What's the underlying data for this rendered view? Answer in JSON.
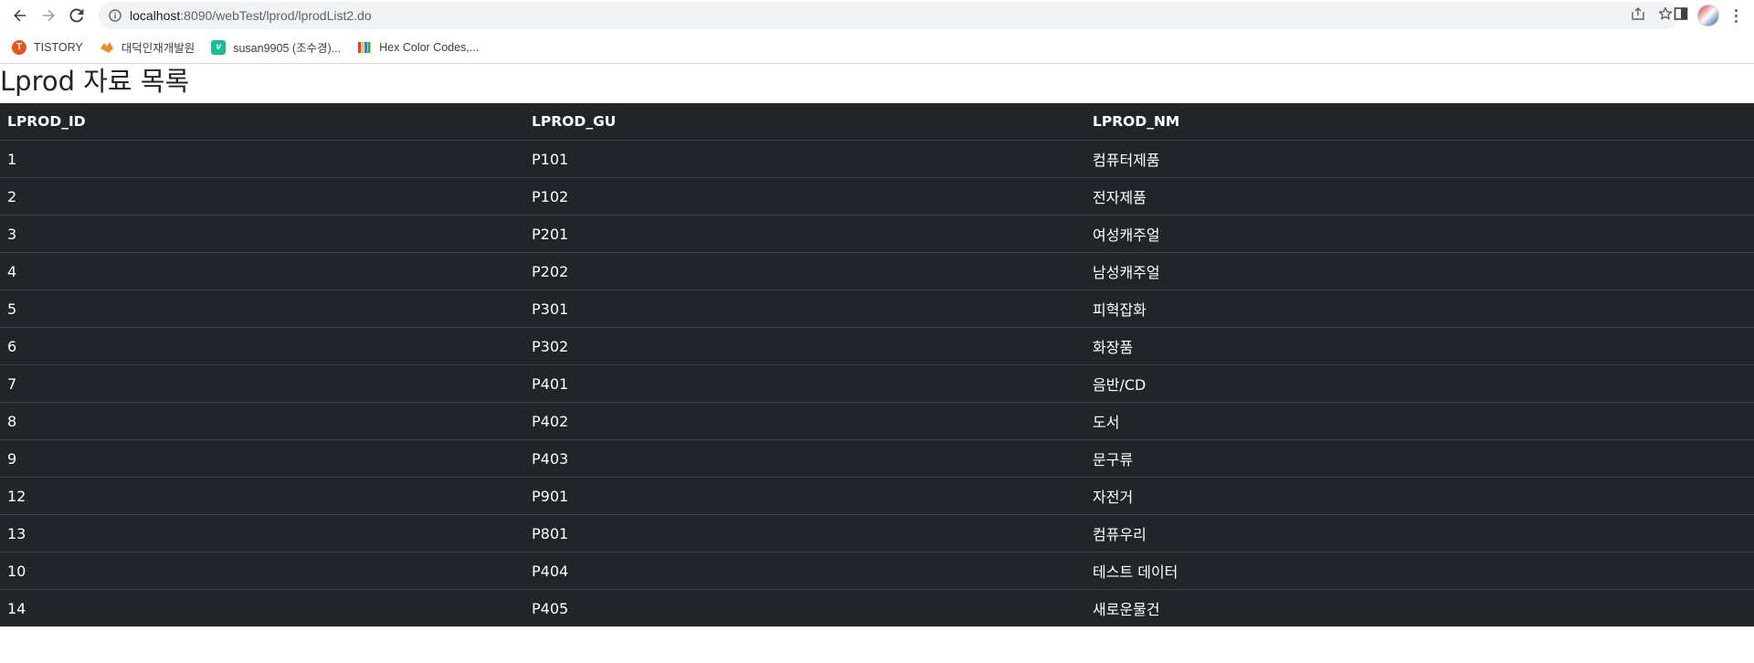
{
  "browser": {
    "url_host": "localhost",
    "url_rest": ":8090/webTest/lprod/lprodList2.do"
  },
  "bookmarks": [
    {
      "label": "TISTORY",
      "icon": "tistory-icon"
    },
    {
      "label": "대덕인재개발원",
      "icon": "daedeok-icon"
    },
    {
      "label": "susan9905 (조수경)...",
      "icon": "velog-icon"
    },
    {
      "label": "Hex Color Codes,...",
      "icon": "hex-color-icon"
    }
  ],
  "page": {
    "title": "Lprod 자료 목록"
  },
  "table": {
    "headers": [
      "LPROD_ID",
      "LPROD_GU",
      "LPROD_NM"
    ],
    "rows": [
      [
        "1",
        "P101",
        "컴퓨터제품"
      ],
      [
        "2",
        "P102",
        "전자제품"
      ],
      [
        "3",
        "P201",
        "여성캐주얼"
      ],
      [
        "4",
        "P202",
        "남성캐주얼"
      ],
      [
        "5",
        "P301",
        "피혁잡화"
      ],
      [
        "6",
        "P302",
        "화장품"
      ],
      [
        "7",
        "P401",
        "음반/CD"
      ],
      [
        "8",
        "P402",
        "도서"
      ],
      [
        "9",
        "P403",
        "문구류"
      ],
      [
        "12",
        "P901",
        "자전거"
      ],
      [
        "13",
        "P801",
        "컴퓨우리"
      ],
      [
        "10",
        "P404",
        "테스트 데이터"
      ],
      [
        "14",
        "P405",
        "새로운물건"
      ]
    ]
  },
  "colors": {
    "table_bg": "#212529",
    "table_border": "#3b4046",
    "omnibox_bg": "#f1f3f4"
  }
}
